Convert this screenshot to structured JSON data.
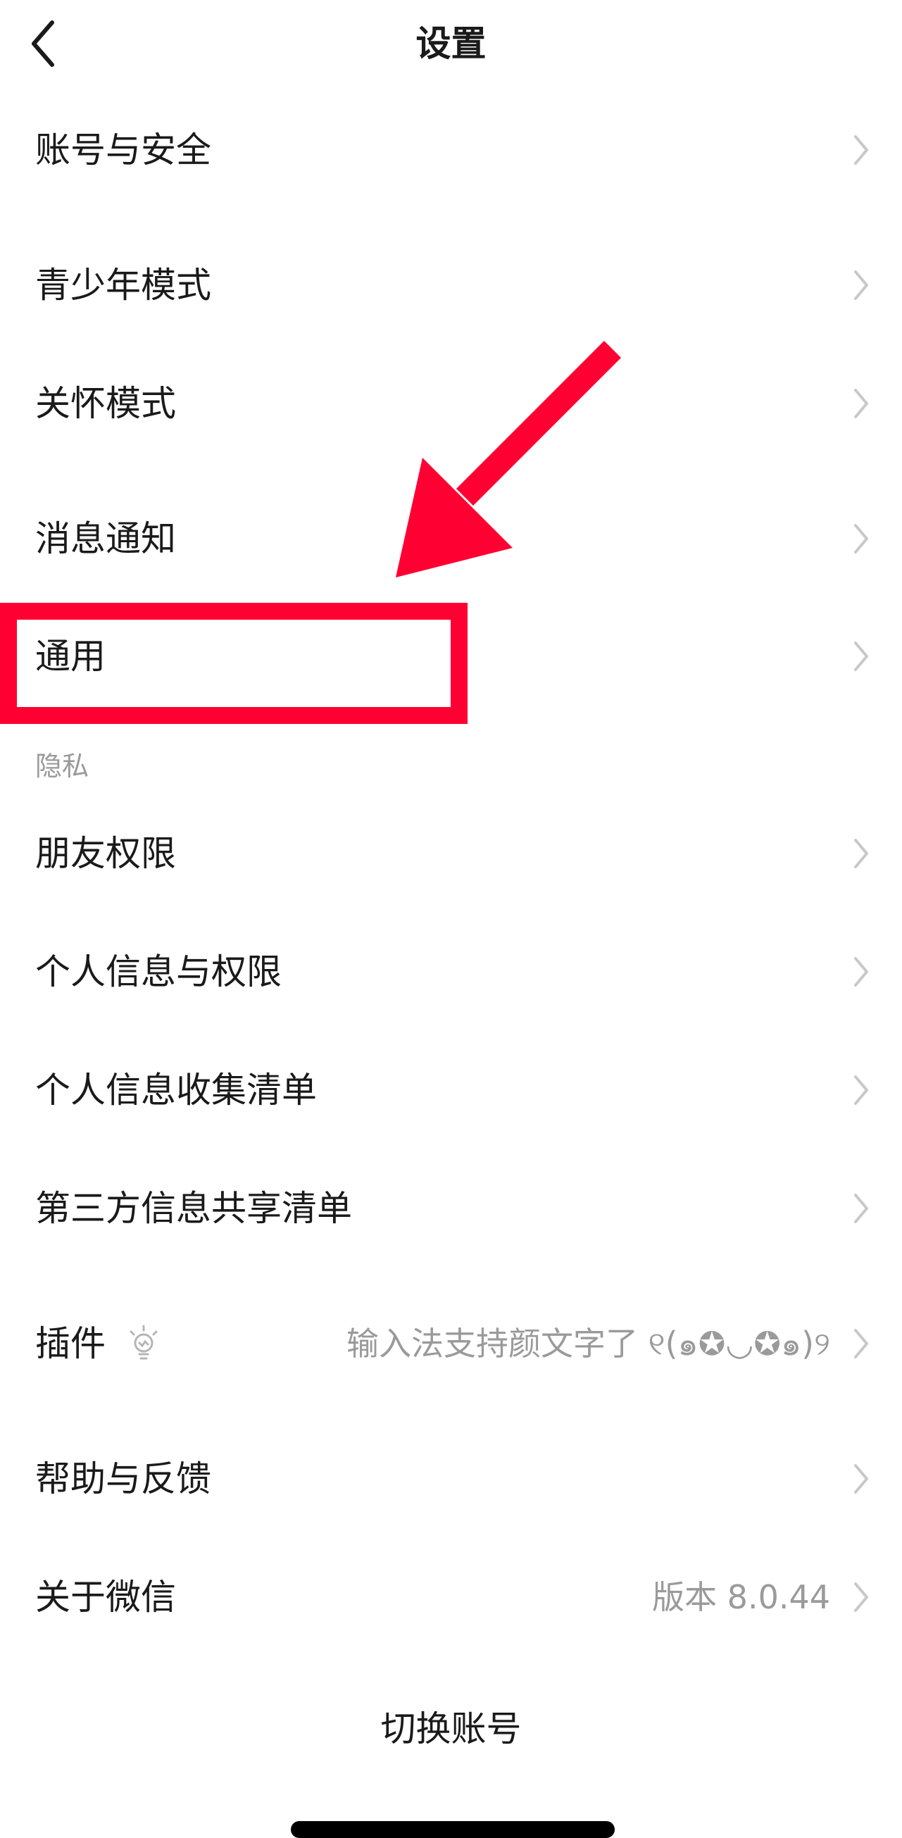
{
  "nav": {
    "title": "设置"
  },
  "settings": {
    "account_security": "账号与安全",
    "youth_mode": "青少年模式",
    "care_mode": "关怀模式",
    "notifications": "消息通知",
    "general": "通用",
    "privacy_header": "隐私",
    "friend_permissions": "朋友权限",
    "personal_info_permissions": "个人信息与权限",
    "personal_info_list": "个人信息收集清单",
    "third_party_list": "第三方信息共享清单",
    "plugins": "插件",
    "plugins_hint": "输入法支持颜文字了 ୧(๑✪◡✪๑)୨",
    "help_feedback": "帮助与反馈",
    "about": "关于微信",
    "version": "版本 8.0.44",
    "switch_account": "切换账号"
  },
  "colors": {
    "annotation": "#ff0033",
    "secondary_text": "#9a9a9a",
    "primary_text": "#1a1a1a"
  },
  "icons": {
    "back": "chevron-left-icon",
    "row_arrow": "chevron-right-icon",
    "plugin_badge": "lightbulb-icon"
  }
}
